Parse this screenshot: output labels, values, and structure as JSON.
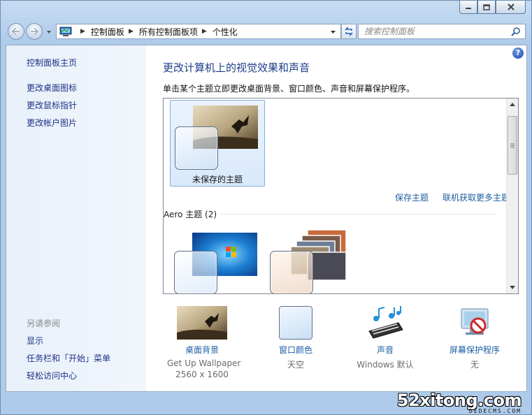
{
  "breadcrumb": [
    "控制面板",
    "所有控制面板项",
    "个性化"
  ],
  "search": {
    "placeholder": "搜索控制面板"
  },
  "sidebar": {
    "home": "控制面板主页",
    "links": [
      "更改桌面图标",
      "更改鼠标指针",
      "更改帐户图片"
    ],
    "see_also_heading": "另请参阅",
    "see_also": [
      "显示",
      "任务栏和「开始」菜单",
      "轻松访问中心"
    ]
  },
  "main": {
    "title": "更改计算机上的视觉效果和声音",
    "description": "单击某个主题立即更改桌面背景、窗口颜色、声音和屏幕保护程序。",
    "unsaved_theme_label": "未保存的主题",
    "save_theme": "保存主题",
    "get_more_themes": "联机获取更多主题",
    "aero_group_label": "Aero 主题 (2)"
  },
  "bottom": {
    "desktop_background": {
      "label": "桌面背景",
      "line1": "Get Up Wallpaper",
      "line2": "2560 x 1600"
    },
    "window_color": {
      "label": "窗口颜色",
      "line1": "天空"
    },
    "sounds": {
      "label": "声音",
      "line1": "Windows 默认"
    },
    "screensaver": {
      "label": "屏幕保护程序",
      "line1": "无"
    }
  },
  "watermark": {
    "main": "52xitong.com",
    "sub": "DEDECMS.COM"
  },
  "colors": {
    "link": "#1e5fa3",
    "title": "#1e3f8a",
    "selected_bg": "#d9e9fb"
  }
}
